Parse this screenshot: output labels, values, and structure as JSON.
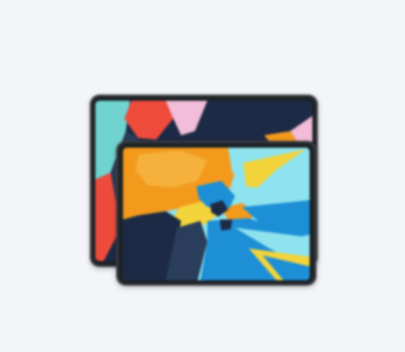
{
  "image": {
    "subject": "ipad-pro-pair-icon",
    "icon_name": "tablet-devices-icon",
    "colors": {
      "background": "#f3f5f9",
      "bezel": "#1f2126",
      "frame": "#3a3c42",
      "orange": "#f39a1e",
      "yellow": "#f3d43a",
      "cyan": "#8ee3ee",
      "blue": "#1f8fd6",
      "navy": "#1d2c44",
      "red": "#ef4b3c",
      "pink": "#f1bdd8",
      "teal": "#6fd3d0"
    }
  }
}
